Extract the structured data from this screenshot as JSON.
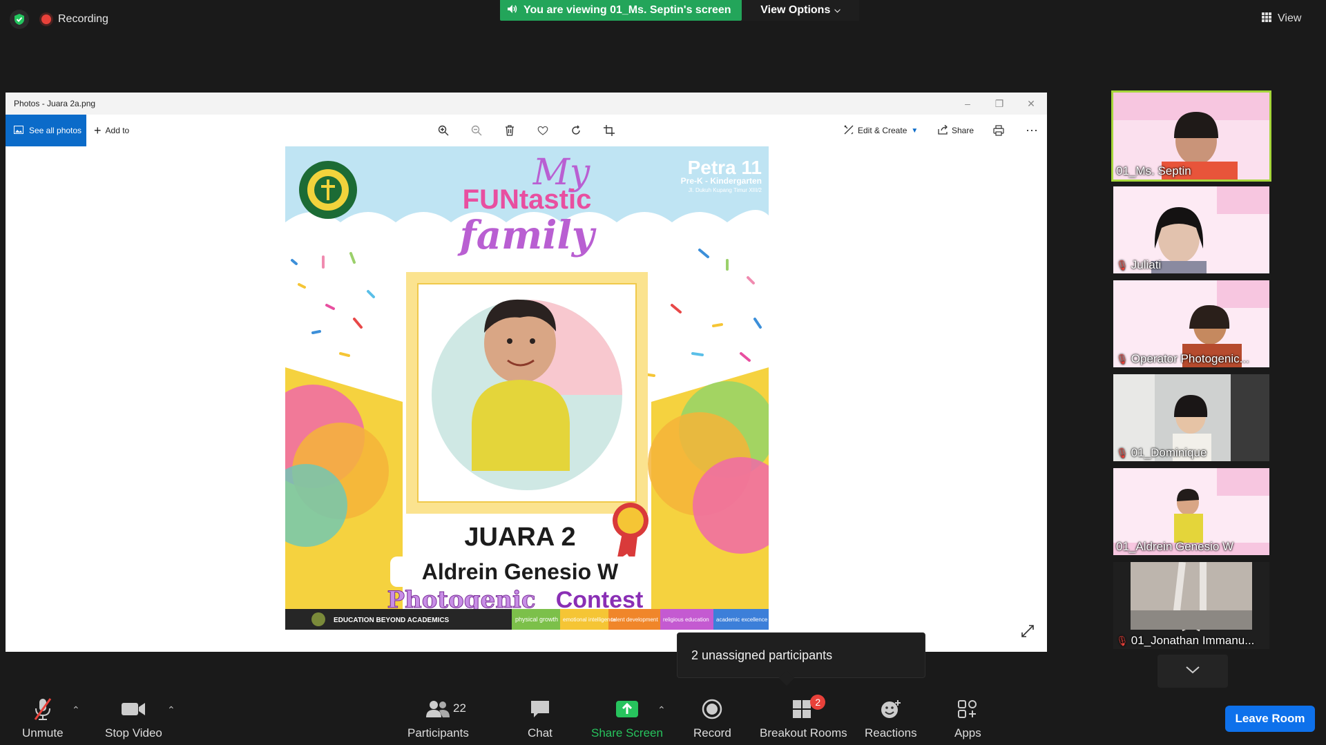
{
  "top": {
    "recording_label": "Recording",
    "viewing_label": "You are viewing 01_Ms. Septin's screen",
    "view_options_label": "View Options",
    "view_label": "View"
  },
  "photos": {
    "window_title": "Photos - Juara 2a.png",
    "see_all_label": "See all photos",
    "add_to_label": "Add to",
    "edit_create_label": "Edit & Create",
    "share_label": "Share"
  },
  "poster": {
    "brand": "Petra 11",
    "brand_sub": "Pre-K - Kindergarten",
    "brand_addr": "Jl. Dukuh Kupang Timur XIII/2",
    "title_my": "My",
    "title_fun": "FUNtastic",
    "title_family": "family",
    "juara": "JUARA 2",
    "name": "Aldrein Genesio W",
    "contest_a": "Photogenic",
    "contest_b": "Contest",
    "footer_left": "EDUCATION BEYOND ACADEMICS",
    "footer_items": [
      "physical growth",
      "emotional intelligence",
      "talent development",
      "religious education",
      "academic excellence"
    ]
  },
  "participants": [
    {
      "name": "01_Ms. Septin",
      "muted": false,
      "active": true
    },
    {
      "name": "Juliati",
      "muted": true,
      "active": false
    },
    {
      "name": "Operator Photogenic...",
      "muted": true,
      "active": false
    },
    {
      "name": "01_Dominique",
      "muted": true,
      "active": false
    },
    {
      "name": "01_Aldrein Genesio W",
      "muted": false,
      "active": false
    },
    {
      "name": "01_Jonathan Immanu...",
      "muted": true,
      "active": false
    }
  ],
  "tooltip": "2 unassigned participants",
  "controls": {
    "unmute": "Unmute",
    "stop_video": "Stop Video",
    "participants": "Participants",
    "participants_count": "22",
    "chat": "Chat",
    "share_screen": "Share Screen",
    "record": "Record",
    "breakout": "Breakout Rooms",
    "breakout_badge": "2",
    "reactions": "Reactions",
    "apps": "Apps",
    "leave": "Leave Room"
  },
  "colors": {
    "accent_green": "#23a55a",
    "leave_blue": "#0e71eb",
    "active_outline": "#a6d63b",
    "badge_red": "#e8413a"
  }
}
